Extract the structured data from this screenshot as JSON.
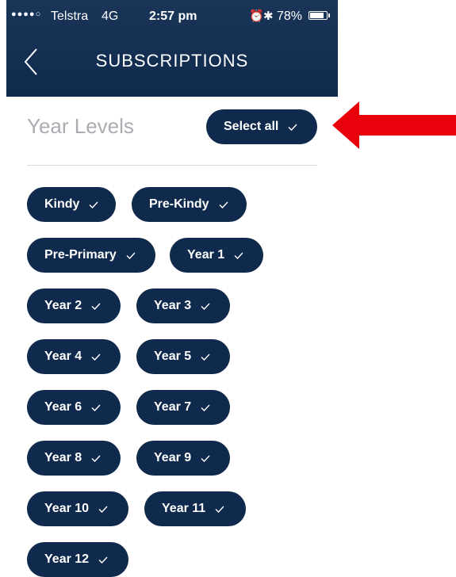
{
  "status_bar": {
    "signal": "●●●●○",
    "carrier": "Telstra",
    "network": "4G",
    "time": "2:57 pm",
    "battery": "78%",
    "battery_level": 0.78
  },
  "header": {
    "title": "SUBSCRIPTIONS"
  },
  "section": {
    "title": "Year Levels",
    "select_all_label": "Select all"
  },
  "year_levels": [
    "Kindy",
    "Pre-Kindy",
    "Pre-Primary",
    "Year 1",
    "Year 2",
    "Year 3",
    "Year 4",
    "Year 5",
    "Year 6",
    "Year 7",
    "Year 8",
    "Year 9",
    "Year 10",
    "Year 11",
    "Year 12"
  ],
  "colors": {
    "primary": "#0f2a4c",
    "annotation_arrow": "#e8000a",
    "section_title": "#a9adb2"
  }
}
